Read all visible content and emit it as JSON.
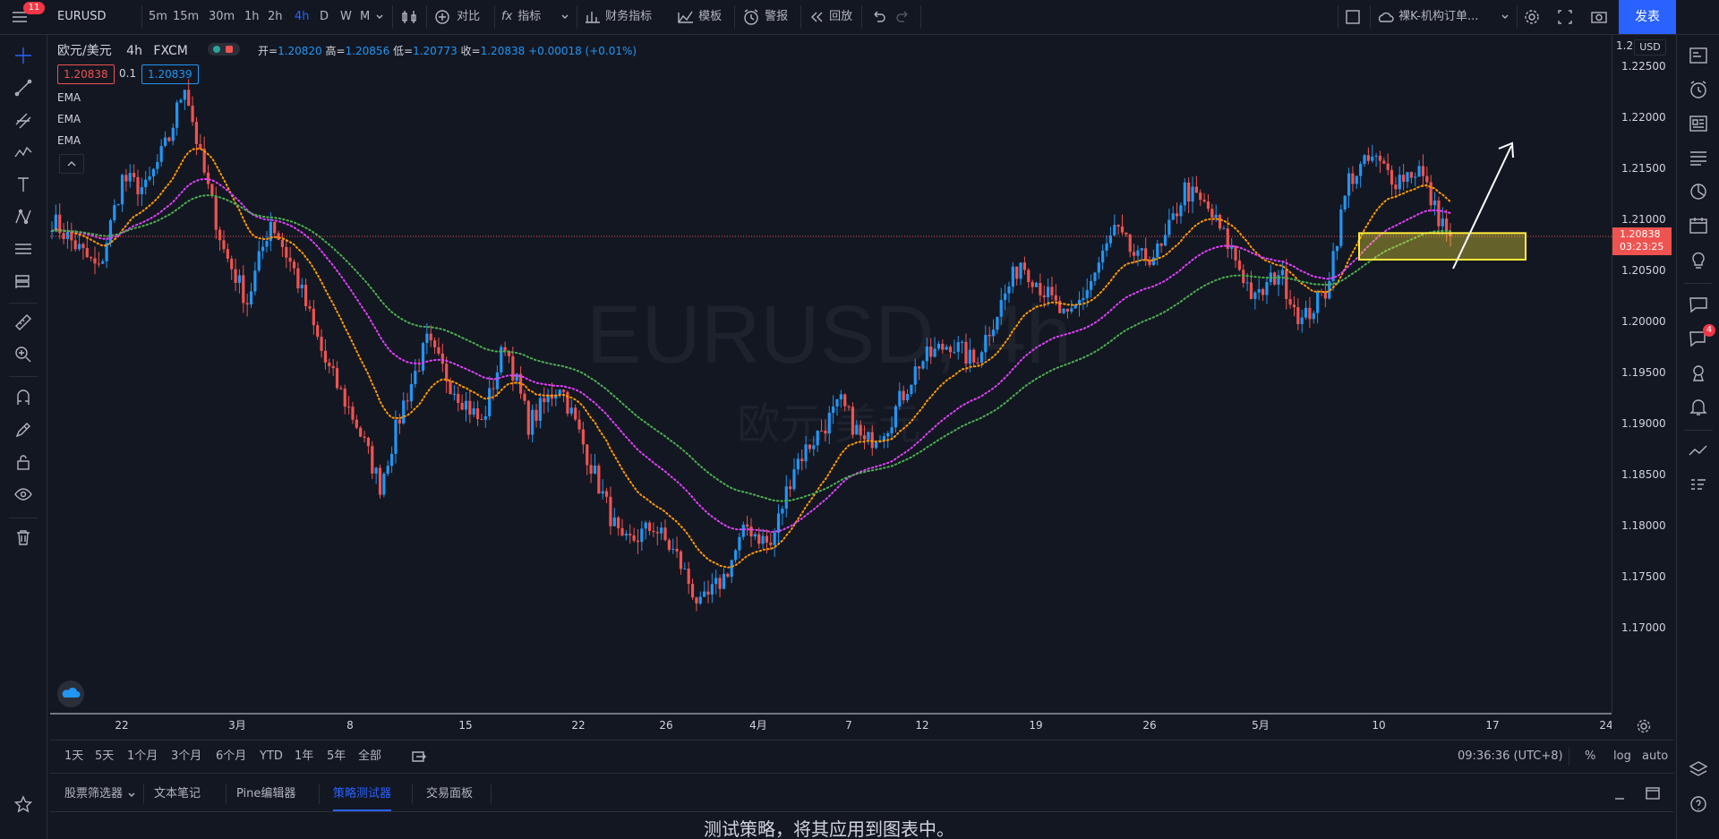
{
  "topbar": {
    "menu_badge": "11",
    "symbol": "EURUSD",
    "timeframes": [
      "5m",
      "15m",
      "30m",
      "1h",
      "2h",
      "4h",
      "D",
      "W",
      "M"
    ],
    "active_timeframe": "4h",
    "compare": "对比",
    "indicators": "指标",
    "financials": "财务指标",
    "templates": "模板",
    "alerts": "警报",
    "replay": "回放",
    "layout_name": "裸K-机构订单...",
    "publish": "发表"
  },
  "legend": {
    "pair": "欧元/美元",
    "interval": "4h",
    "source": "FXCM",
    "open_label": "开=",
    "open": "1.20820",
    "high_label": "高=",
    "high": "1.20856",
    "low_label": "低=",
    "low": "1.20773",
    "close_label": "收=",
    "close": "1.20838",
    "change": "+0.00018 (+0.01%)",
    "sell_price": "1.20838",
    "spread": "0.1",
    "buy_price": "1.20839",
    "indicators": [
      "EMA",
      "EMA",
      "EMA"
    ]
  },
  "watermark": {
    "symbol": "EURUSD, 4h",
    "name": "欧元/美元"
  },
  "price_axis": {
    "currency": "USD",
    "labels": [
      "1.22500",
      "1.22000",
      "1.21500",
      "1.21000",
      "1.20500",
      "1.20000",
      "1.19500",
      "1.19000",
      "1.18500",
      "1.18000",
      "1.17500",
      "1.17000"
    ],
    "top_label": "1.2",
    "last_price": "1.20838",
    "countdown": "03:23:25"
  },
  "time_axis": {
    "labels": [
      "22",
      "3月",
      "8",
      "15",
      "22",
      "26",
      "4月",
      "7",
      "12",
      "19",
      "26",
      "5月",
      "10",
      "17",
      "24"
    ]
  },
  "rangebar": {
    "ranges": [
      "1天",
      "5天",
      "1个月",
      "3个月",
      "6个月",
      "YTD",
      "1年",
      "5年",
      "全部"
    ],
    "clock": "09:36:36 (UTC+8)",
    "percent": "%",
    "log": "log",
    "auto": "auto"
  },
  "panels": {
    "tabs": [
      "股票筛选器",
      "文本笔记",
      "Pine编辑器",
      "策略测试器",
      "交易面板"
    ],
    "active": "策略测试器",
    "message": "测试策略，将其应用到图表中。"
  },
  "right_badge": "4",
  "colors": {
    "up": "#2196f3",
    "down": "#ef5350",
    "ema_fast": "#ff9800",
    "ema_mid": "#e040fb",
    "ema_slow": "#4caf50",
    "zone": "#ffeb3b",
    "accent": "#2962ff"
  },
  "chart_data": {
    "type": "candlestick",
    "price_range": [
      1.167,
      1.228
    ],
    "current_price": 1.20838,
    "key_levels": {
      "zone_low": 1.2061,
      "zone_high": 1.2087
    },
    "ema_series": [
      {
        "name": "EMA",
        "color": "#ff9800"
      },
      {
        "name": "EMA",
        "color": "#e040fb"
      },
      {
        "name": "EMA",
        "color": "#4caf50"
      }
    ],
    "anchors": [
      [
        0,
        1.21
      ],
      [
        12,
        1.205
      ],
      [
        18,
        1.214
      ],
      [
        24,
        1.213
      ],
      [
        30,
        1.218
      ],
      [
        34,
        1.2235
      ],
      [
        38,
        1.216
      ],
      [
        44,
        1.207
      ],
      [
        50,
        1.202
      ],
      [
        56,
        1.21
      ],
      [
        62,
        1.205
      ],
      [
        70,
        1.196
      ],
      [
        78,
        1.19
      ],
      [
        84,
        1.184
      ],
      [
        90,
        1.192
      ],
      [
        96,
        1.198
      ],
      [
        102,
        1.194
      ],
      [
        110,
        1.19
      ],
      [
        116,
        1.198
      ],
      [
        122,
        1.19
      ],
      [
        130,
        1.194
      ],
      [
        138,
        1.186
      ],
      [
        146,
        1.178
      ],
      [
        154,
        1.18
      ],
      [
        160,
        1.177
      ],
      [
        166,
        1.172
      ],
      [
        172,
        1.175
      ],
      [
        178,
        1.18
      ],
      [
        184,
        1.178
      ],
      [
        190,
        1.186
      ],
      [
        196,
        1.189
      ],
      [
        202,
        1.192
      ],
      [
        208,
        1.188
      ],
      [
        214,
        1.19
      ],
      [
        222,
        1.196
      ],
      [
        230,
        1.198
      ],
      [
        236,
        1.196
      ],
      [
        242,
        1.201
      ],
      [
        248,
        1.206
      ],
      [
        254,
        1.203
      ],
      [
        260,
        1.2
      ],
      [
        266,
        1.204
      ],
      [
        272,
        1.209
      ],
      [
        278,
        1.206
      ],
      [
        284,
        1.207
      ],
      [
        290,
        1.213
      ],
      [
        296,
        1.211
      ],
      [
        302,
        1.207
      ],
      [
        308,
        1.202
      ],
      [
        314,
        1.205
      ],
      [
        320,
        1.2
      ],
      [
        326,
        1.203
      ],
      [
        332,
        1.214
      ],
      [
        338,
        1.216
      ],
      [
        344,
        1.214
      ],
      [
        350,
        1.215
      ],
      [
        354,
        1.211
      ],
      [
        358,
        1.2084
      ]
    ]
  }
}
